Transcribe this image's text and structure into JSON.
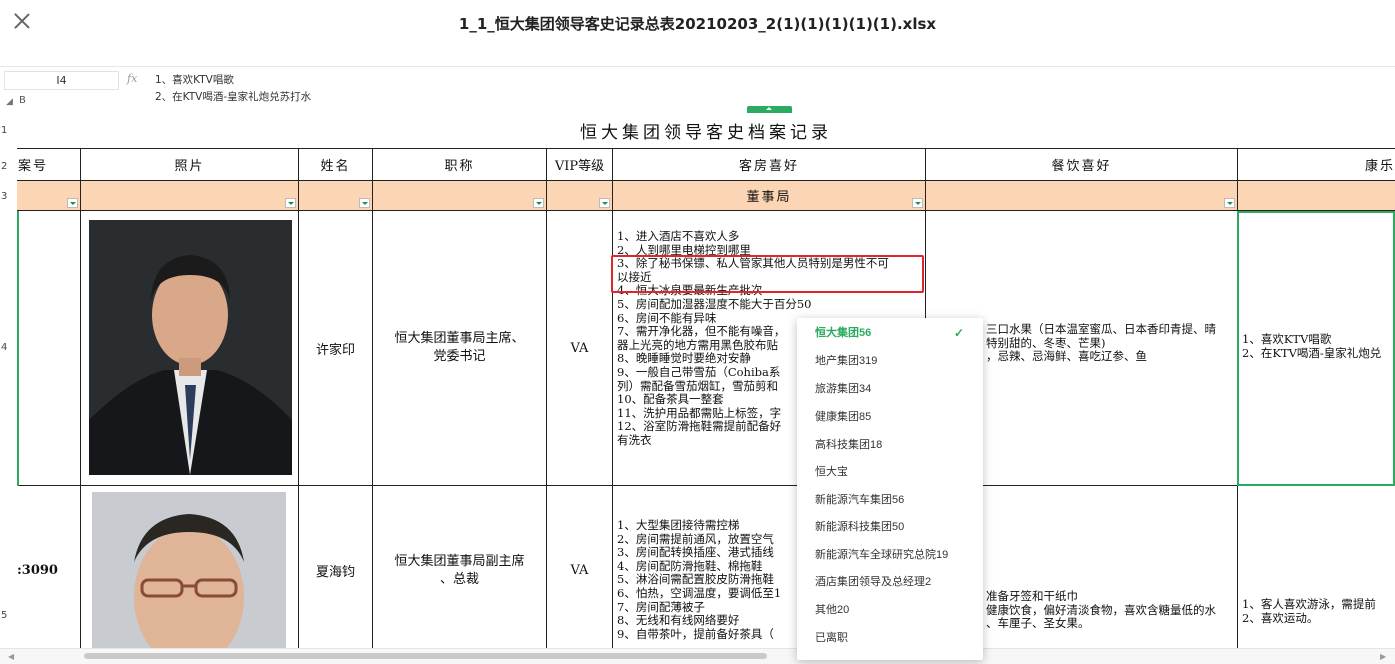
{
  "window": {
    "title": "1_1_恒大集团领导客史记录总表20210203_2(1)(1)(1)(1)(1).xlsx"
  },
  "formula_bar": {
    "cell_ref": "I4",
    "fx": "fx",
    "lines": [
      "1、喜欢KTV唱歌",
      "2、在KTV喝酒-皇家礼炮兑苏打水"
    ]
  },
  "column_indicator": {
    "b": "B"
  },
  "row_headers": [
    "1",
    "2",
    "3",
    "4",
    "5"
  ],
  "sheet": {
    "title": "恒大集团领导客史档案记录",
    "headers": [
      "案号",
      "照片",
      "姓名",
      "职称",
      "VIP等级",
      "客房喜好",
      "餐饮喜好",
      "康乐"
    ],
    "dept": "董事局",
    "rows": [
      {
        "case_no": "",
        "name": "许家印",
        "title": "恒大集团董事局主席、\n党委书记",
        "vip": "VA",
        "room": "1、进入酒店不喜欢人多\n2、人到哪里电梯控到哪里\n3、除了秘书保镖、私人管家其他人员特别是男性不可\n以接近\n4、恒大冰泉要最新生产批次\n5、房间配加湿器湿度不能大于百分50\n6、房间不能有异味\n7、需开净化器，但不能有噪音，\n器上光亮的地方需用黑色胶布贴\n8、晚睡睡觉时要绝对安静\n9、一般自己带雪茄（Cohiba系\n列）需配备雪茄烟缸，雪茄剪和\n10、配备茶具一整套\n11、洗护用品都需贴上标签，字\n12、浴室防滑拖鞋需提前配备好\n有洗衣",
        "food": "三口水果（日本温室蜜瓜、日本香印青提、晴\n特别甜的、冬枣、芒果)\n，忌辣、忌海鲜、喜吃辽参、鱼",
        "leisure": "1、喜欢KTV唱歌\n2、在KTV喝酒-皇家礼炮兑"
      },
      {
        "case_no": ":3090",
        "name": "夏海钧",
        "title": "恒大集团董事局副主席\n、总裁",
        "vip": "VA",
        "room": "1、大型集团接待需控梯\n2、房间需提前通风，放置空气\n3、房间配转换插座、港式插线\n4、房间配防滑拖鞋、棉拖鞋\n5、淋浴间需配置胶皮防滑拖鞋\n6、怕热，空调温度，要调低至1\n7、房间配薄被子\n8、无线和有线网络要好\n9、自带茶叶，提前备好茶具（",
        "food": "准备牙签和干纸巾\n健康饮食，偏好清淡食物，喜欢含糖量低的水\n、车厘子、圣女果。",
        "leisure": "1、客人喜欢游泳，需提前\n2、喜欢运动。"
      }
    ]
  },
  "popup": {
    "items": [
      {
        "label": "恒大集团56",
        "selected": true
      },
      {
        "label": "地产集团319",
        "selected": false
      },
      {
        "label": "旅游集团34",
        "selected": false
      },
      {
        "label": "健康集团85",
        "selected": false
      },
      {
        "label": "高科技集团18",
        "selected": false
      },
      {
        "label": "恒大宝",
        "selected": false
      },
      {
        "label": "新能源汽车集团56",
        "selected": false
      },
      {
        "label": "新能源科技集团50",
        "selected": false
      },
      {
        "label": "新能源汽车全球研究总院19",
        "selected": false
      },
      {
        "label": "酒店集团领导及总经理2",
        "selected": false
      },
      {
        "label": "其他20",
        "selected": false
      },
      {
        "label": "已离职",
        "selected": false
      }
    ],
    "check": "✓"
  },
  "colors": {
    "accent": "#2bab5f",
    "dept_bg": "#fcd5b4",
    "highlight": "#e0252b"
  }
}
